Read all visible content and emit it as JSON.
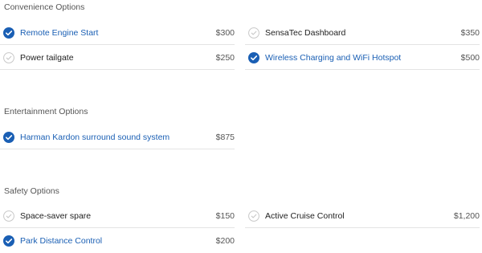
{
  "sections": [
    {
      "title": "Convenience Options",
      "options": [
        {
          "label": "Remote Engine Start",
          "price": "$300",
          "selected": true
        },
        {
          "label": "SensaTec Dashboard",
          "price": "$350",
          "selected": false
        },
        {
          "label": "Power tailgate",
          "price": "$250",
          "selected": false
        },
        {
          "label": "Wireless Charging and WiFi Hotspot",
          "price": "$500",
          "selected": true
        }
      ]
    },
    {
      "title": "Entertainment Options",
      "options": [
        {
          "label": "Harman Kardon surround sound system",
          "price": "$875",
          "selected": true
        }
      ]
    },
    {
      "title": "Safety Options",
      "options": [
        {
          "label": "Space-saver spare",
          "price": "$150",
          "selected": false
        },
        {
          "label": "Active Cruise Control",
          "price": "$1,200",
          "selected": false
        },
        {
          "label": "Park Distance Control",
          "price": "$200",
          "selected": true
        }
      ]
    }
  ],
  "colors": {
    "selected_accent": "#1a5fb4",
    "unselected_check": "#c8c8c8"
  },
  "icons": {
    "selected": "check-circle-filled-icon",
    "unselected": "check-circle-outline-icon"
  }
}
